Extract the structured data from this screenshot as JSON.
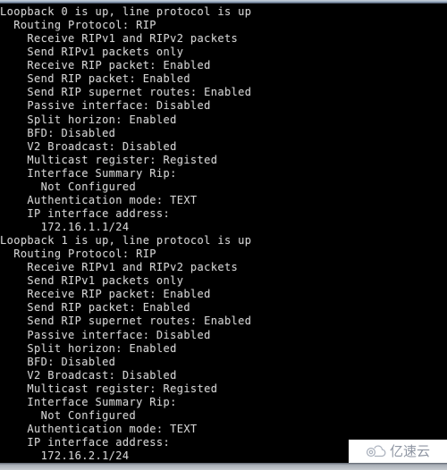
{
  "terminal": {
    "background_color": "#000000",
    "text_color": "#d2d2d2",
    "console_output": "Loopback 0 is up, line protocol is up\n  Routing Protocol: RIP\n    Receive RIPv1 and RIPv2 packets\n    Send RIPv1 packets only\n    Receive RIP packet: Enabled\n    Send RIP packet: Enabled\n    Send RIP supernet routes: Enabled\n    Passive interface: Disabled\n    Split horizon: Enabled\n    BFD: Disabled\n    V2 Broadcast: Disabled\n    Multicast register: Registed\n    Interface Summary Rip:\n      Not Configured\n    Authentication mode: TEXT\n    IP interface address:\n      172.16.1.1/24\nLoopback 1 is up, line protocol is up\n  Routing Protocol: RIP\n    Receive RIPv1 and RIPv2 packets\n    Send RIPv1 packets only\n    Receive RIP packet: Enabled\n    Send RIP packet: Enabled\n    Send RIP supernet routes: Enabled\n    Passive interface: Disabled\n    Split horizon: Enabled\n    BFD: Disabled\n    V2 Broadcast: Disabled\n    Multicast register: Registed\n    Interface Summary Rip:\n      Not Configured\n    Authentication mode: TEXT\n    IP interface address:\n      172.16.2.1/24",
    "lines": [
      "Loopback 0 is up, line protocol is up",
      "  Routing Protocol: RIP",
      "    Receive RIPv1 and RIPv2 packets",
      "    Send RIPv1 packets only",
      "    Receive RIP packet: Enabled",
      "    Send RIP packet: Enabled",
      "    Send RIP supernet routes: Enabled",
      "    Passive interface: Disabled",
      "    Split horizon: Enabled",
      "    BFD: Disabled",
      "    V2 Broadcast: Disabled",
      "    Multicast register: Registed",
      "    Interface Summary Rip:",
      "      Not Configured",
      "    Authentication mode: TEXT",
      "    IP interface address:",
      "      172.16.1.1/24",
      "Loopback 1 is up, line protocol is up",
      "  Routing Protocol: RIP",
      "    Receive RIPv1 and RIPv2 packets",
      "    Send RIPv1 packets only",
      "    Receive RIP packet: Enabled",
      "    Send RIP packet: Enabled",
      "    Send RIP supernet routes: Enabled",
      "    Passive interface: Disabled",
      "    Split horizon: Enabled",
      "    BFD: Disabled",
      "    V2 Broadcast: Disabled",
      "    Multicast register: Registed",
      "    Interface Summary Rip:",
      "      Not Configured",
      "    Authentication mode: TEXT",
      "    IP interface address:",
      "      172.16.2.1/24"
    ],
    "interfaces": [
      {
        "name": "Loopback 0",
        "status": "is up, line protocol is up",
        "routing_protocol": "RIP",
        "receive_versions": "Receive RIPv1 and RIPv2 packets",
        "send_versions": "Send RIPv1 packets only",
        "receive_rip_packet": "Enabled",
        "send_rip_packet": "Enabled",
        "send_rip_supernet_routes": "Enabled",
        "passive_interface": "Disabled",
        "split_horizon": "Enabled",
        "bfd": "Disabled",
        "v2_broadcast": "Disabled",
        "multicast_register": "Registed",
        "interface_summary_rip": "Not Configured",
        "authentication_mode": "TEXT",
        "ip_interface_address": "172.16.1.1/24"
      },
      {
        "name": "Loopback 1",
        "status": "is up, line protocol is up",
        "routing_protocol": "RIP",
        "receive_versions": "Receive RIPv1 and RIPv2 packets",
        "send_versions": "Send RIPv1 packets only",
        "receive_rip_packet": "Enabled",
        "send_rip_packet": "Enabled",
        "send_rip_supernet_routes": "Enabled",
        "passive_interface": "Disabled",
        "split_horizon": "Enabled",
        "bfd": "Disabled",
        "v2_broadcast": "Disabled",
        "multicast_register": "Registed",
        "interface_summary_rip": "Not Configured",
        "authentication_mode": "TEXT",
        "ip_interface_address": "172.16.2.1/24"
      }
    ]
  },
  "watermark": {
    "text": "亿速云",
    "icon": "cloud-icon",
    "color": "#8f96a3",
    "background_color": "#ffffff"
  }
}
